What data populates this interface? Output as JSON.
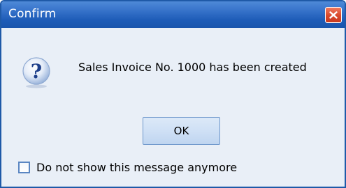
{
  "window": {
    "title": "Confirm",
    "close_icon": "close-icon"
  },
  "dialog": {
    "icon": "question-icon",
    "message": "Sales Invoice No. 1000 has been created",
    "ok_label": "OK",
    "checkbox_label": "Do not show this message anymore",
    "checkbox_checked": false
  },
  "colors": {
    "titlebar": "#1e5cb8",
    "body": "#e9eff7",
    "close": "#d9482a"
  }
}
